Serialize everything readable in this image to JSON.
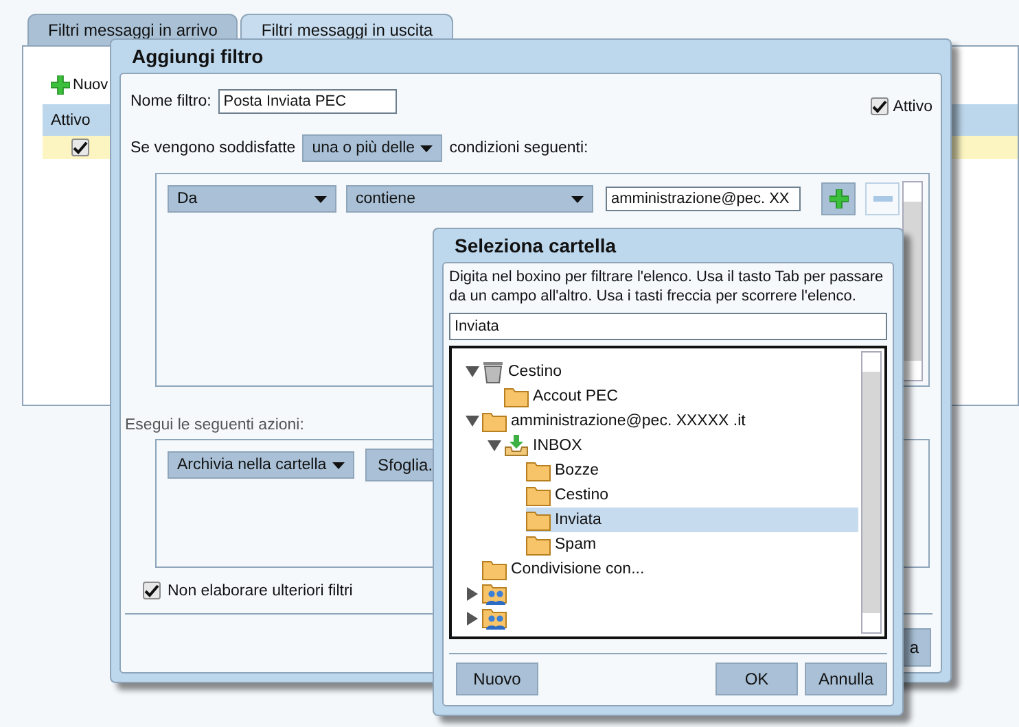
{
  "tabs": [
    {
      "label": "Filtri messaggi in arrivo",
      "selected": false
    },
    {
      "label": "Filtri messaggi in uscita",
      "selected": true
    }
  ],
  "toolbar": {
    "new_button": "Nuov"
  },
  "table": {
    "columns": [
      "Attivo"
    ],
    "rows": [
      {
        "active": true,
        "selected": true
      }
    ]
  },
  "filter_dialog": {
    "title": "Aggiungi filtro",
    "name_label": "Nome filtro:",
    "name_value": "Posta Inviata PEC",
    "active": {
      "label": "Attivo",
      "checked": true
    },
    "match_prefix": "Se vengono soddisfatte",
    "match_mode": "una o più delle",
    "match_suffix": "condizioni seguenti:",
    "conditions": [
      {
        "field": "Da",
        "operator": "contiene",
        "value": "amministrazione@pec. XX"
      }
    ],
    "actions_label": "Esegui le seguenti azioni:",
    "actions": [
      {
        "action": "Archivia nella cartella",
        "button": "Sfoglia."
      }
    ],
    "stop": {
      "label": "Non elaborare ulteriori filtri",
      "checked": true
    },
    "footer_button": "a"
  },
  "folder_dialog": {
    "title": "Seleziona cartella",
    "hint": "Digita nel boxino per filtrare l'elenco. Usa il tasto Tab per passare da un campo all'altro. Usa i tasti freccia per scorrere l'elenco.",
    "search_value": "Inviata",
    "tree": [
      {
        "kind": "trash",
        "label": "Cestino",
        "expanded": true,
        "selected": false,
        "children": [
          {
            "kind": "folder",
            "label": "Accout PEC",
            "selected": false
          }
        ]
      },
      {
        "kind": "folder",
        "label": "amministrazione@pec. XXXXX  .it",
        "expanded": true,
        "selected": false,
        "children": [
          {
            "kind": "inbox",
            "label": "INBOX",
            "expanded": true,
            "selected": false,
            "children": [
              {
                "kind": "folder",
                "label": "Bozze",
                "selected": false
              },
              {
                "kind": "folder",
                "label": "Cestino",
                "selected": false
              },
              {
                "kind": "folder",
                "label": "Inviata",
                "selected": true
              },
              {
                "kind": "folder",
                "label": "Spam",
                "selected": false
              }
            ]
          }
        ]
      },
      {
        "kind": "folder",
        "label": "Condivisione con...",
        "selected": false
      },
      {
        "kind": "shared",
        "expanded": false,
        "selected": false
      },
      {
        "kind": "shared",
        "expanded": false,
        "selected": false
      }
    ],
    "buttons": [
      "Nuovo",
      "OK",
      "Annulla"
    ]
  }
}
